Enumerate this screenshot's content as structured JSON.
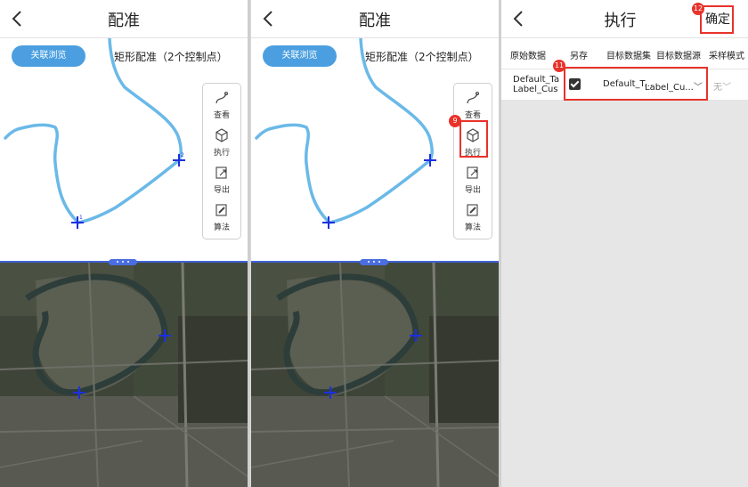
{
  "panels": [
    {
      "title": "配准",
      "assoc_button": "关联浏览",
      "map_title": "矩形配准（2个控制点）",
      "tools": [
        {
          "icon": "curve-icon",
          "label": "查看"
        },
        {
          "icon": "cube-icon",
          "label": "执行"
        },
        {
          "icon": "export-icon",
          "label": "导出"
        },
        {
          "icon": "algorithm-icon",
          "label": "算法"
        }
      ],
      "control_points": [
        "1",
        "2"
      ]
    },
    {
      "title": "配准",
      "assoc_button": "关联浏览",
      "map_title": "矩形配准（2个控制点）",
      "tools": [
        {
          "icon": "curve-icon",
          "label": "查看"
        },
        {
          "icon": "cube-icon",
          "label": "执行"
        },
        {
          "icon": "export-icon",
          "label": "导出"
        },
        {
          "icon": "algorithm-icon",
          "label": "算法"
        }
      ],
      "step_badge": "9"
    },
    {
      "title": "执行",
      "confirm": "确定",
      "confirm_badge": "12",
      "columns": [
        "原始数据",
        "另存",
        "目标数据集",
        "目标数据源",
        "采样模式"
      ],
      "row": {
        "source_line1": "Default_Ta",
        "source_line2": "Label_Cus",
        "save_as_checked": true,
        "target_dataset": "Default_T...",
        "target_datasource": "Label_Cu...",
        "sampling_mode": "无"
      },
      "row_badge": "11"
    }
  ],
  "colors": {
    "accent": "#4b9fe0",
    "river": "#6ab9e8",
    "control_point": "#1d2fe0",
    "highlight": "#e8322a"
  }
}
